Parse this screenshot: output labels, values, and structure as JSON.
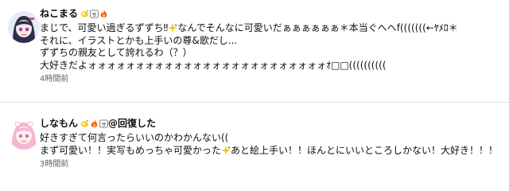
{
  "comments": [
    {
      "author": "ねこまる",
      "badges": [
        "lemon-icon",
        "sa-badge-icon",
        "fire-icon"
      ],
      "lines": [
        "まじで、可愛い過ぎるずずち‼",
        "なんでそんなに可愛いだぁぁぁぁぁぁ＊本当ぐへへf(((((((←ﾔﾒﾛ＊",
        "それに、イラストとかも上手いの尊&歌だし...",
        "ずずちの親友として誇れるわ（？）",
        "大好きだよォォォォォォォォォォォォォォォォォォォォォォォォォｵ□□(((((((((("
      ],
      "time": "4時間前"
    },
    {
      "author": "しなもん",
      "badges": [
        "lemon-icon",
        "fire-icon",
        "sa-badge-icon"
      ],
      "suffix": "@回復した",
      "lines": [
        "好きすぎて何言ったらいいのかわかんない((",
        "まず可愛い！！実写もめっちゃ可愛かった",
        "あと絵上手い！！ほんとにいいところしかない！大好き！！！"
      ],
      "time": "3時間前"
    }
  ]
}
